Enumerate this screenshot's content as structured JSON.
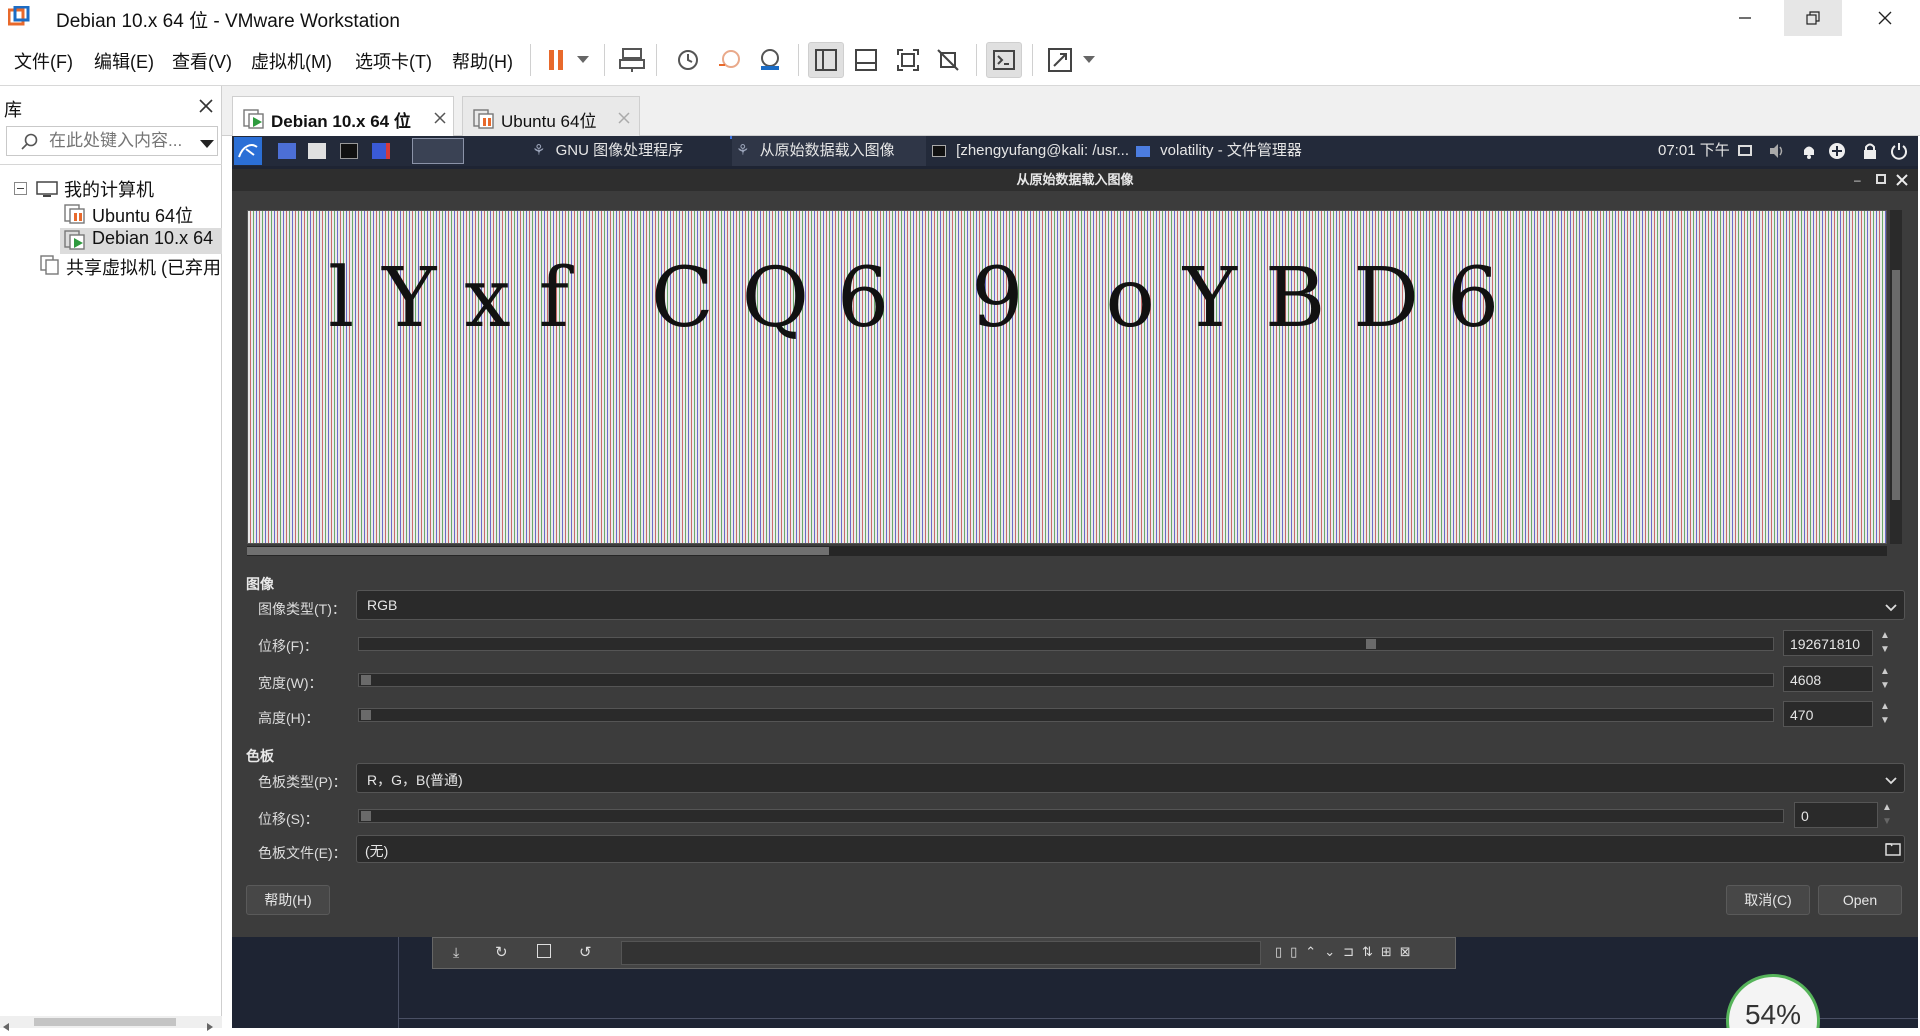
{
  "window": {
    "title": "Debian 10.x 64 位 - VMware Workstation"
  },
  "menu": {
    "items": [
      "文件(F)",
      "编辑(E)",
      "查看(V)",
      "虚拟机(M)",
      "选项卡(T)",
      "帮助(H)"
    ]
  },
  "library": {
    "title": "库",
    "search_placeholder": "在此处键入内容...",
    "tree": {
      "root": "我的计算机",
      "vm1": "Ubuntu 64位",
      "vm2": "Debian 10.x 64",
      "shared": "共享虚拟机 (已弃用"
    }
  },
  "tabs": [
    {
      "label": "Debian 10.x 64 位"
    },
    {
      "label": "Ubuntu 64位"
    }
  ],
  "guest": {
    "panel": {
      "tasks": [
        "GNU 图像处理程序",
        "从原始数据载入图像",
        "[zhengyufang@kali: /usr...",
        "volatility - 文件管理器"
      ],
      "clock": "07:01 下午"
    },
    "dialog": {
      "title": "从原始数据载入图像",
      "preview_text": "lYxf CQ6 9 oYBD6",
      "image_section": "图像",
      "image_type_label": "图像类型(T)：",
      "image_type_value": "RGB",
      "offset_label": "位移(F)：",
      "offset_value": "192671810",
      "offset_fraction": 0.717,
      "width_label": "宽度(W)：",
      "width_value": "4608",
      "height_label": "高度(H)：",
      "height_value": "470",
      "palette_section": "色板",
      "palette_type_label": "色板类型(P)：",
      "palette_type_value": "R，G，B(普通)",
      "palette_offset_label": "位移(S)：",
      "palette_offset_value": "0",
      "palette_file_label": "色板文件(E)：",
      "palette_file_value": "(无)",
      "help_button": "帮助(H)",
      "cancel_button": "取消(C)",
      "open_button": "Open"
    },
    "progress": "54%"
  },
  "colors": {
    "pause": "#e8692b",
    "vm_green": "#2e9b3e",
    "guest_bg": "#1e2433",
    "dialog_bg": "#3c3c3c"
  }
}
